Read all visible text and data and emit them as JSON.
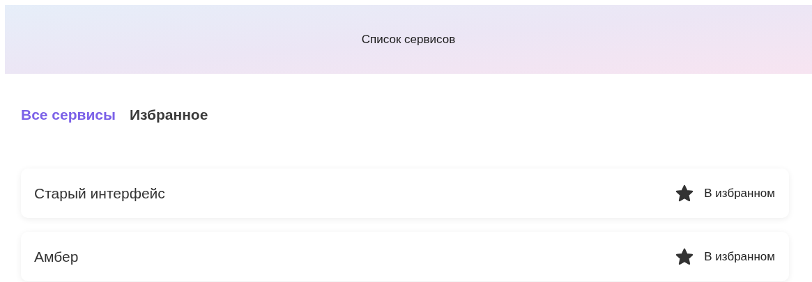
{
  "header": {
    "title": "Список сервисов"
  },
  "tabs": [
    {
      "label": "Все сервисы",
      "selected": true
    },
    {
      "label": "Избранное",
      "selected": false
    }
  ],
  "services": [
    {
      "name": "Старый интерфейс",
      "favorite": true,
      "favorite_label": "В избранном"
    },
    {
      "name": "Амбер",
      "favorite": true,
      "favorite_label": "В избранном"
    }
  ]
}
